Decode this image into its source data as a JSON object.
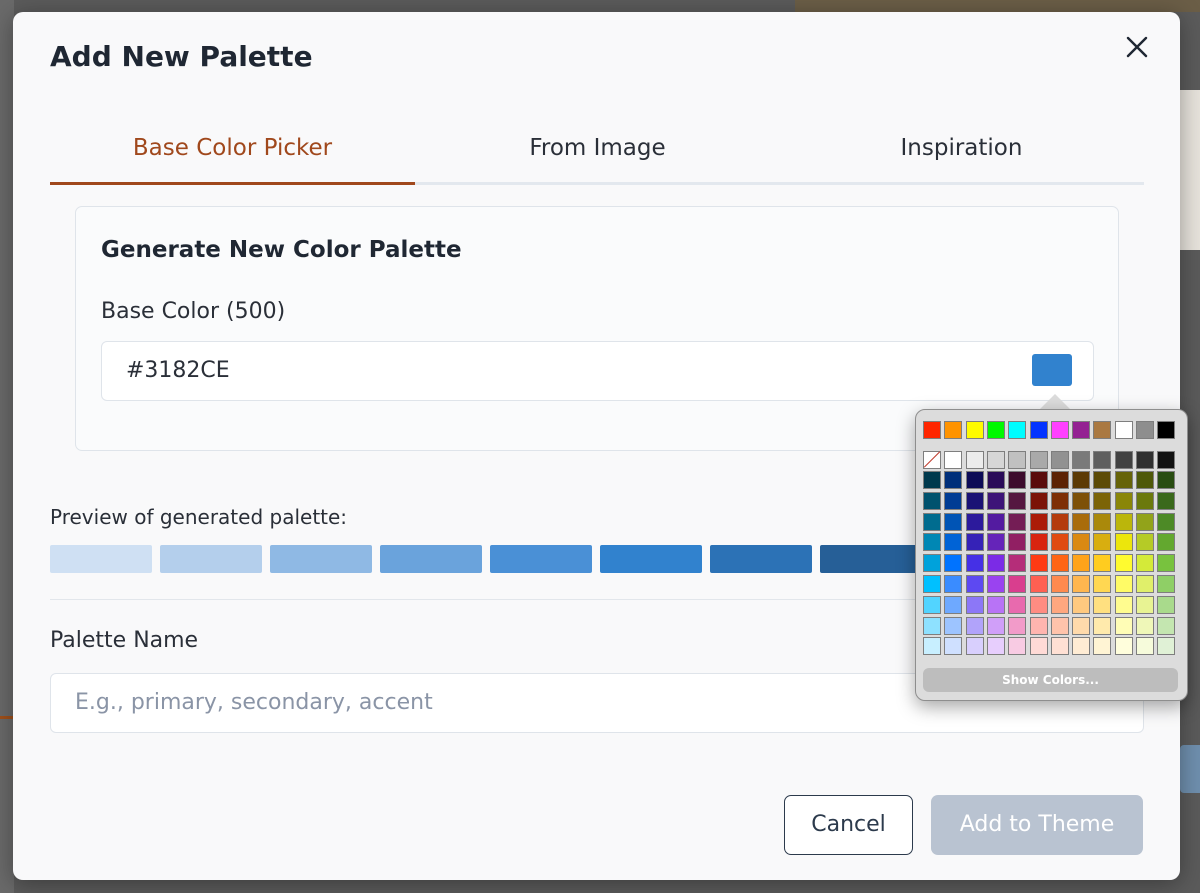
{
  "modal": {
    "title": "Add New Palette"
  },
  "tabs": [
    {
      "label": "Base Color Picker",
      "active": true
    },
    {
      "label": "From Image",
      "active": false
    },
    {
      "label": "Inspiration",
      "active": false
    }
  ],
  "generator": {
    "heading": "Generate New Color Palette",
    "base_color_label": "Base Color (500)",
    "base_color_value": "#3182CE",
    "swatch_color": "#3182ce"
  },
  "preview": {
    "label": "Preview of generated palette:",
    "swatches": [
      "#cfe0f3",
      "#b4cfec",
      "#8fb9e4",
      "#6aa3dc",
      "#4a90d6",
      "#3182ce",
      "#2c72b6",
      "#265f97"
    ]
  },
  "palette_name": {
    "label": "Palette Name",
    "placeholder": "E.g., primary, secondary, accent"
  },
  "buttons": {
    "cancel": "Cancel",
    "add": "Add to Theme"
  },
  "color_picker": {
    "top_row": [
      "#ff2600",
      "#ff9300",
      "#fffb00",
      "#00f900",
      "#00fdff",
      "#0433ff",
      "#ff40ff",
      "#942192",
      "#aa7942",
      "#ffffff",
      "#8e8e8e",
      "#000000"
    ],
    "grey_row": [
      "none",
      "#ffffff",
      "#ececec",
      "#d6d6d6",
      "#c0c0c0",
      "#a9a9a9",
      "#929292",
      "#7a7a7a",
      "#5f5f5f",
      "#424242",
      "#303030",
      "#121212"
    ],
    "hues": [
      [
        "#00394d",
        "#002f7a",
        "#0c0b57",
        "#2a0b58",
        "#3d0b2c",
        "#5a0b0b",
        "#5c2204",
        "#5c3a05",
        "#5d4b06",
        "#666308",
        "#4e5808",
        "#294d12"
      ],
      [
        "#00526e",
        "#003c94",
        "#1a1275",
        "#3d1478",
        "#551740",
        "#7b1307",
        "#7e2f06",
        "#7d5008",
        "#7c6407",
        "#8a8608",
        "#6b790c",
        "#3a691b"
      ],
      [
        "#006c8f",
        "#0054b5",
        "#2c1a9c",
        "#531ba0",
        "#741d55",
        "#ab1b08",
        "#b43b0c",
        "#a96c0b",
        "#aa890b",
        "#bbb60b",
        "#92a31a",
        "#4d8a26"
      ],
      [
        "#0087b4",
        "#0063d6",
        "#3522b7",
        "#6524b9",
        "#911f63",
        "#d8240f",
        "#e04a11",
        "#da8912",
        "#d8ae10",
        "#ece60c",
        "#b5cb26",
        "#63a82f"
      ],
      [
        "#00a2db",
        "#0073ff",
        "#4530e6",
        "#7b2be6",
        "#b52d79",
        "#ff3a14",
        "#ff6515",
        "#ffa31a",
        "#ffcc1f",
        "#fffb2f",
        "#d4ea39",
        "#78c23e"
      ],
      [
        "#00c0ff",
        "#3a8cff",
        "#5d49f2",
        "#9a43f0",
        "#d93e8e",
        "#ff6052",
        "#ff8a4f",
        "#ffb64f",
        "#ffd752",
        "#fffb66",
        "#e0ef6a",
        "#8fcf66"
      ],
      [
        "#52d4ff",
        "#6ea9ff",
        "#8c77f7",
        "#b873f6",
        "#e86aae",
        "#ff8c82",
        "#ffa77f",
        "#ffc97f",
        "#ffe080",
        "#fffc8f",
        "#e8f393",
        "#a9da8c"
      ],
      [
        "#8ee1ff",
        "#9dc4ff",
        "#b1a3fa",
        "#d09ff9",
        "#f29bc9",
        "#ffb5af",
        "#ffc3ab",
        "#ffdaab",
        "#ffeaac",
        "#fffdb6",
        "#eff7b8",
        "#c4e6b0"
      ],
      [
        "#c8efff",
        "#cfe0ff",
        "#d8cffd",
        "#e7cefd",
        "#f8cbe3",
        "#ffdad6",
        "#ffe0d4",
        "#ffecd4",
        "#fff4d4",
        "#fffedc",
        "#f6fbdb",
        "#e0f1d6"
      ]
    ],
    "show_colors_label": "Show Colors..."
  }
}
